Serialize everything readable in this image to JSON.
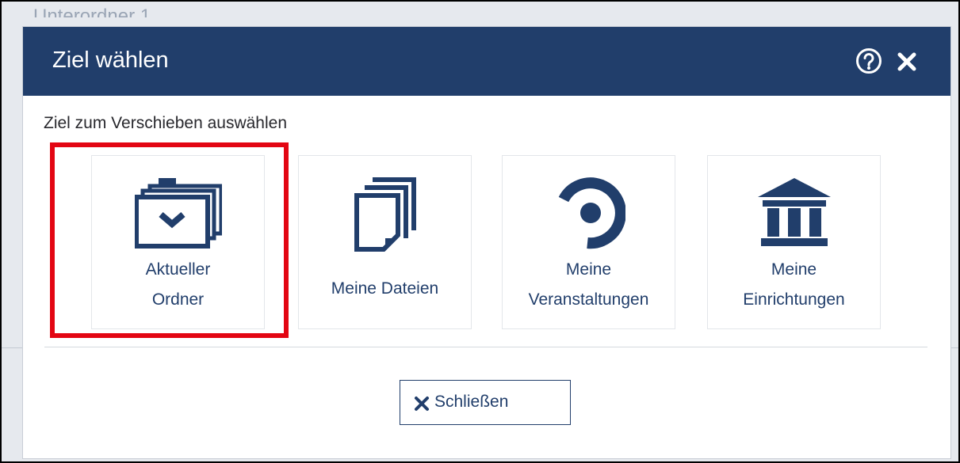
{
  "background": {
    "partial_text": "Unterordner 1"
  },
  "dialog": {
    "title": "Ziel wählen",
    "help_icon": "help-circle-icon",
    "close_icon": "close-x-icon",
    "subtitle": "Ziel zum Verschieben auswählen",
    "options": [
      {
        "line1": "Aktueller",
        "line2": "Ordner",
        "icon": "folder-stack-icon",
        "highlighted": true
      },
      {
        "line1": "Meine Dateien",
        "line2": "",
        "icon": "files-icon",
        "highlighted": false
      },
      {
        "line1": "Meine",
        "line2": "Veranstaltungen",
        "icon": "seminar-icon",
        "highlighted": false
      },
      {
        "line1": "Meine",
        "line2": "Einrichtungen",
        "icon": "institution-icon",
        "highlighted": false
      }
    ],
    "close_button": {
      "label": "Schließen",
      "icon": "close-x-icon"
    }
  },
  "colors": {
    "header": "#213e6b",
    "accent": "#213e6b",
    "highlight": "#e30613"
  }
}
